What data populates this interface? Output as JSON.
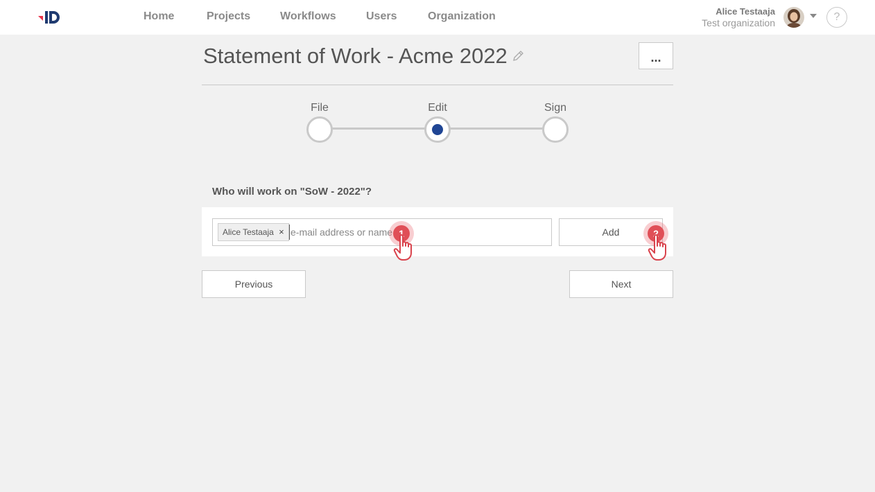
{
  "nav": {
    "items": [
      "Home",
      "Projects",
      "Workflows",
      "Users",
      "Organization"
    ]
  },
  "user": {
    "name": "Alice Testaaja",
    "organization": "Test organization",
    "help_label": "?"
  },
  "document": {
    "title": "Statement of Work - Acme 2022",
    "more_label": "..."
  },
  "stepper": {
    "steps": [
      {
        "label": "File",
        "active": false
      },
      {
        "label": "Edit",
        "active": true
      },
      {
        "label": "Sign",
        "active": false
      }
    ]
  },
  "collaborators": {
    "question": "Who will work on \"SoW - 2022\"?",
    "chips": [
      {
        "label": "Alice Testaaja",
        "remove": "×"
      }
    ],
    "input_placeholder": "e-mail address or name",
    "add_label": "Add"
  },
  "footer": {
    "previous_label": "Previous",
    "next_label": "Next"
  },
  "hotspots": [
    {
      "number": "1"
    },
    {
      "number": "2"
    }
  ],
  "colors": {
    "accent": "#1f4594",
    "logo_red": "#e8334a",
    "hotspot": "#e04f57"
  }
}
